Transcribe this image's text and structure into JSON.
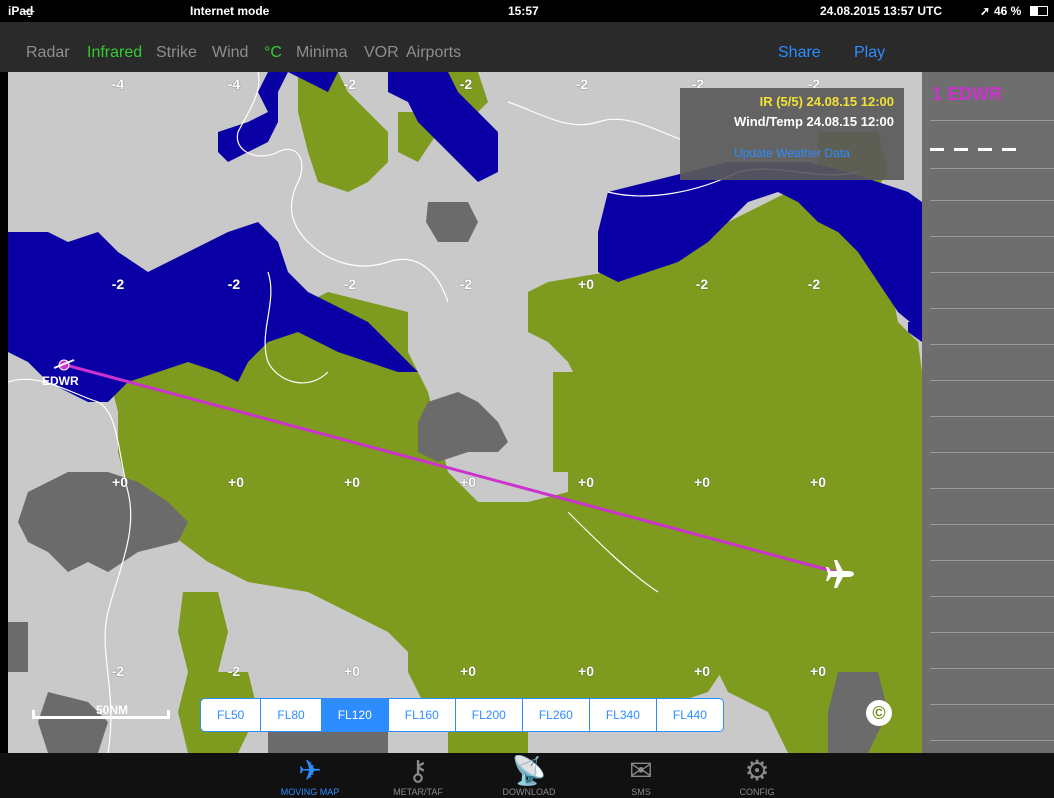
{
  "status": {
    "device": "iPad",
    "mode": "Internet mode",
    "time": "15:57",
    "utc": "24.08.2015 13:57 UTC",
    "battery": "46 %"
  },
  "toolbar": {
    "layers": [
      {
        "label": "Radar",
        "active": false
      },
      {
        "label": "Infrared",
        "active": true
      },
      {
        "label": "Strike",
        "active": false
      },
      {
        "label": "Wind",
        "active": false
      },
      {
        "label": "°C",
        "active": true
      },
      {
        "label": "Minima",
        "active": false
      },
      {
        "label": "VOR",
        "active": false
      },
      {
        "label": "Airports",
        "active": false
      }
    ],
    "share": "Share",
    "play": "Play"
  },
  "info": {
    "ir_line": "IR (5/5) 24.08.15 12:00",
    "wind_line": "Wind/Temp 24.08.15 12:00",
    "update": "Update Weather Data"
  },
  "route": {
    "waypoint": "1 EDWR",
    "airport_label": "EDWR"
  },
  "temps": {
    "row1": [
      "-4",
      "-4",
      "-2",
      "-2",
      "-2",
      "-2",
      "-2"
    ],
    "row2": [
      "-2",
      "-2",
      "-2",
      "-2",
      "+0",
      "-2",
      "-2"
    ],
    "row3": [
      "+0",
      "+0",
      "+0",
      "+0",
      "+0",
      "+0",
      "+0"
    ],
    "row4": [
      "-2",
      "-2",
      "+0",
      "+0",
      "+0",
      "+0",
      "+0"
    ]
  },
  "scale": "50NM",
  "flight_levels": [
    "FL50",
    "FL80",
    "FL120",
    "FL160",
    "FL200",
    "FL260",
    "FL340",
    "FL440"
  ],
  "selected_fl": "FL120",
  "copyright": "©",
  "tabs": [
    {
      "label": "MOVING MAP",
      "icon": "airplane-icon",
      "active": true
    },
    {
      "label": "METAR/TAF",
      "icon": "key-icon",
      "active": false
    },
    {
      "label": "DOWNLOAD",
      "icon": "satellite-dish-icon",
      "active": false
    },
    {
      "label": "SMS",
      "icon": "envelope-icon",
      "active": false
    },
    {
      "label": "CONFIG",
      "icon": "gear-icon",
      "active": false
    }
  ],
  "colors": {
    "land_green": "#7e9a1f",
    "cloud_blue": "#0a00a6",
    "cloud_grey": "#6b6b6b",
    "background_grey": "#c9c9c9",
    "route": "#cc33cc",
    "accent": "#2d8cff"
  }
}
